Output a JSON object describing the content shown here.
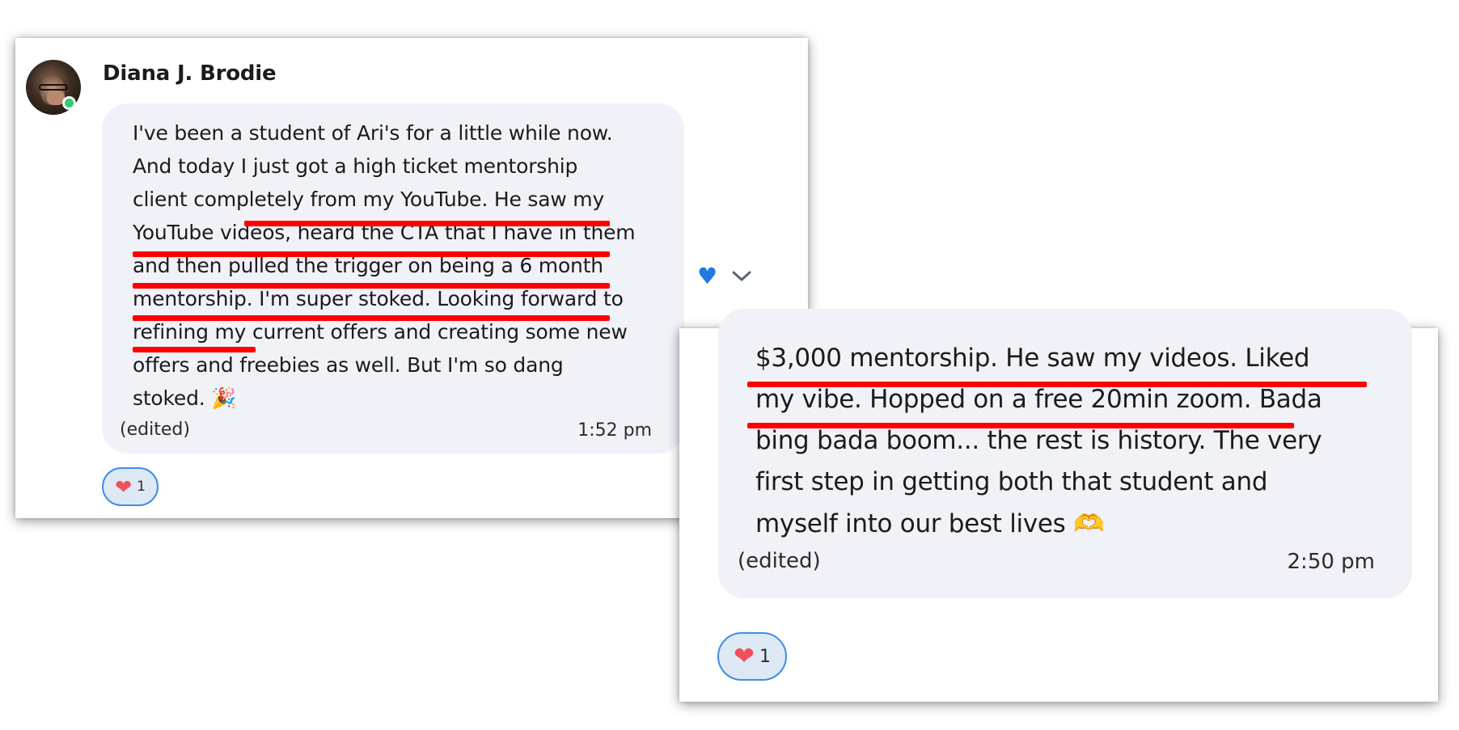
{
  "message1": {
    "author": "Diana J. Brodie",
    "lines": [
      "I've been a student of Ari's for a little while now.",
      "And today I just got a high ticket mentorship",
      "client completely from my YouTube. He saw my",
      "YouTube videos, heard the CTA that I have in them",
      "and then pulled the trigger on being a 6 month",
      "mentorship. I'm super stoked. Looking forward to",
      "refining my current offers and creating some new",
      "offers and freebies as well. But I'm so dang",
      "stoked. 🎉"
    ],
    "edited": "(edited)",
    "time": "1:52 pm",
    "reaction": {
      "emoji": "❤",
      "count": "1"
    }
  },
  "message2": {
    "lines": [
      "$3,000 mentorship. He saw my videos. Liked",
      "my vibe. Hopped on a free 20min zoom. Bada",
      "bing bada boom... the rest is history. The very",
      "first step in getting both that student and",
      "myself into our best lives 🫶"
    ],
    "edited": "(edited)",
    "time": "2:50 pm",
    "reaction": {
      "emoji": "❤",
      "count": "1"
    }
  },
  "actions": {
    "like_icon": "♥",
    "more_icon": "chevron-down-icon"
  },
  "colors": {
    "underline": "#ff0000",
    "bubble": "#f0f2f7",
    "reaction_border": "#3c8ee8",
    "heart": "#f0505e",
    "online": "#2ecc71",
    "like": "#1f7ae6"
  }
}
